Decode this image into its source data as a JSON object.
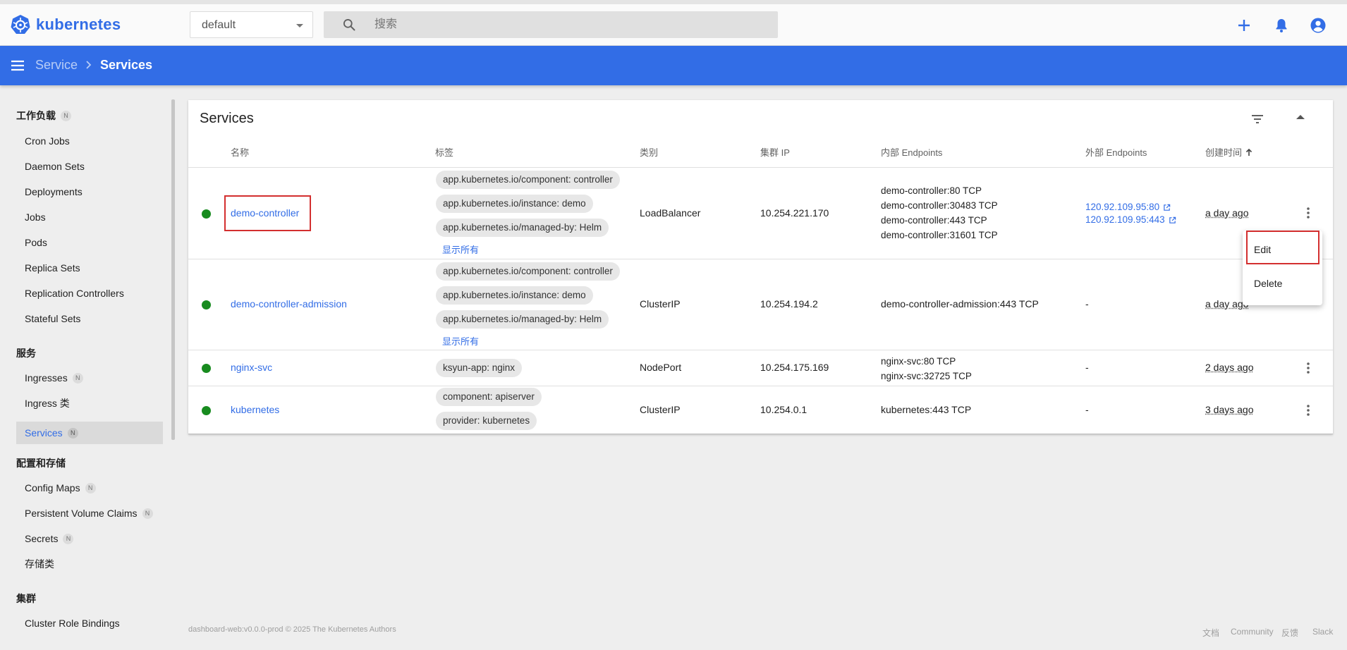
{
  "app": {
    "logo_text": "kubernetes"
  },
  "topbar": {
    "namespace_value": "default",
    "search_placeholder": "搜索",
    "icons": [
      "add-icon",
      "notifications-icon",
      "account-icon"
    ]
  },
  "breadcrumb": {
    "parent": "Service",
    "current": "Services"
  },
  "sidebar": {
    "sections": [
      {
        "title": "工作负载",
        "badge": "N",
        "items": [
          {
            "label": "Cron Jobs"
          },
          {
            "label": "Daemon Sets"
          },
          {
            "label": "Deployments"
          },
          {
            "label": "Jobs"
          },
          {
            "label": "Pods"
          },
          {
            "label": "Replica Sets"
          },
          {
            "label": "Replication Controllers"
          },
          {
            "label": "Stateful Sets"
          }
        ]
      },
      {
        "title": "服务",
        "items": [
          {
            "label": "Ingresses",
            "badge": "N"
          },
          {
            "label": "Ingress 类"
          },
          {
            "label": "Services",
            "badge": "N",
            "active": true
          }
        ]
      },
      {
        "title": "配置和存储",
        "items": [
          {
            "label": "Config Maps",
            "badge": "N"
          },
          {
            "label": "Persistent Volume Claims",
            "badge": "N"
          },
          {
            "label": "Secrets",
            "badge": "N"
          },
          {
            "label": "存储类"
          }
        ]
      },
      {
        "title": "集群",
        "items": [
          {
            "label": "Cluster Role Bindings"
          }
        ]
      }
    ]
  },
  "card": {
    "title": "Services",
    "columns": [
      "名称",
      "标签",
      "类别",
      "集群 IP",
      "内部 Endpoints",
      "外部 Endpoints",
      "创建时间"
    ],
    "show_all_label": "显示所有",
    "rows": [
      {
        "name": "demo-controller",
        "labels": [
          "app.kubernetes.io/component: controller",
          "app.kubernetes.io/instance: demo",
          "app.kubernetes.io/managed-by: Helm"
        ],
        "type": "LoadBalancer",
        "cluster_ip": "10.254.221.170",
        "internal": [
          "demo-controller:80 TCP",
          "demo-controller:30483 TCP",
          "demo-controller:443 TCP",
          "demo-controller:31601 TCP"
        ],
        "external": [
          "120.92.109.95:80",
          "120.92.109.95:443"
        ],
        "age": "a day ago"
      },
      {
        "name": "demo-controller-admission",
        "labels": [
          "app.kubernetes.io/component: controller",
          "app.kubernetes.io/instance: demo",
          "app.kubernetes.io/managed-by: Helm"
        ],
        "type": "ClusterIP",
        "cluster_ip": "10.254.194.2",
        "internal": [
          "demo-controller-admission:443 TCP"
        ],
        "external": "-",
        "age": "a day ago"
      },
      {
        "name": "nginx-svc",
        "labels": [
          "ksyun-app: nginx"
        ],
        "type": "NodePort",
        "cluster_ip": "10.254.175.169",
        "internal": [
          "nginx-svc:80 TCP",
          "nginx-svc:32725 TCP"
        ],
        "external": "-",
        "age": "2 days ago"
      },
      {
        "name": "kubernetes",
        "labels": [
          "component: apiserver",
          "provider: kubernetes"
        ],
        "type": "ClusterIP",
        "cluster_ip": "10.254.0.1",
        "internal": [
          "kubernetes:443 TCP"
        ],
        "external": "-",
        "age": "3 days ago"
      }
    ]
  },
  "menu": {
    "edit": "Edit",
    "delete": "Delete"
  },
  "footer": {
    "copyright": "dashboard-web:v0.0.0-prod © 2025 The Kubernetes Authors",
    "links": [
      "文档",
      "Community",
      "反馈",
      "Slack"
    ]
  },
  "colors": {
    "brand": "#326de6",
    "status_ok": "#188b1f",
    "highlight": "#d32f2f"
  }
}
